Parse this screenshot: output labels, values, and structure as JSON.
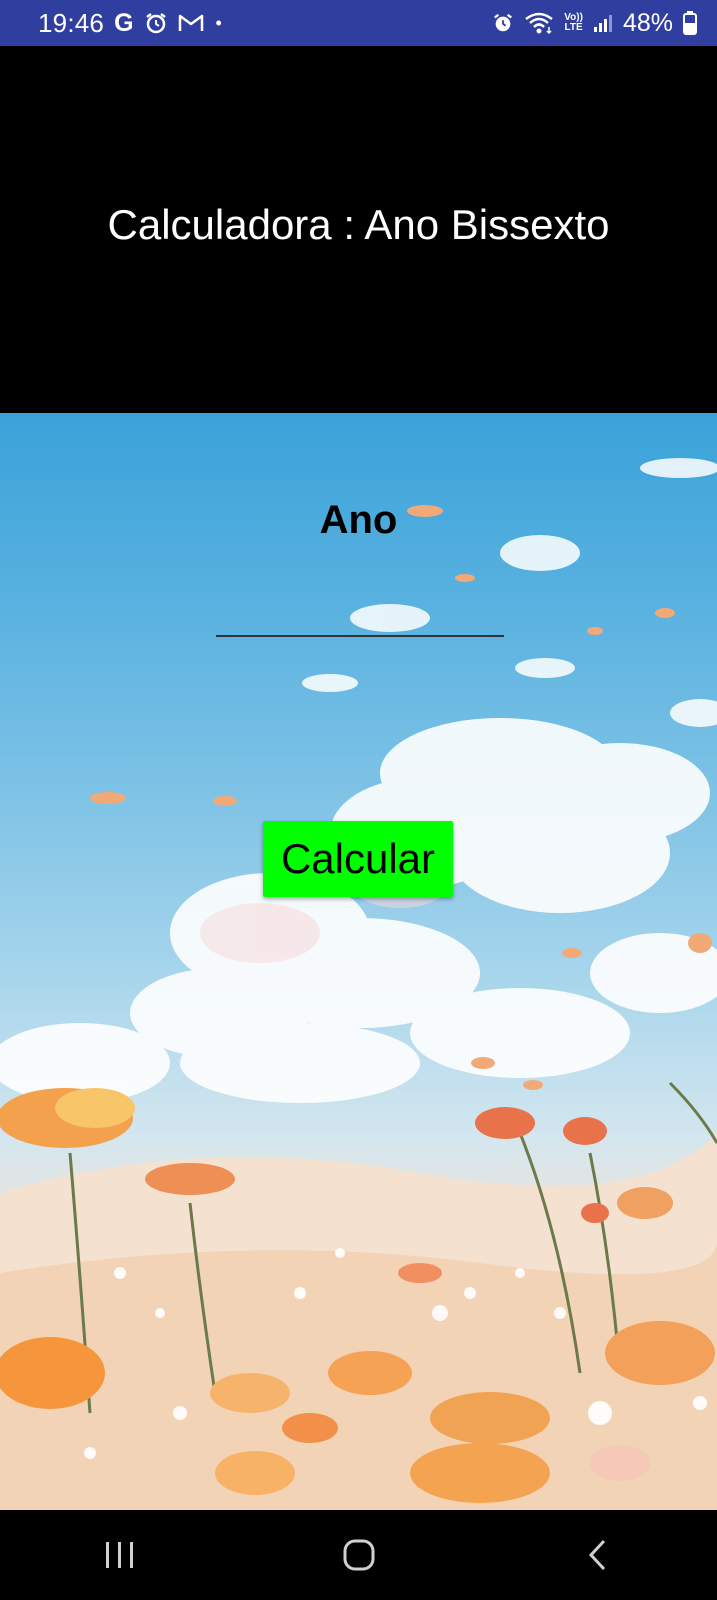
{
  "status_bar": {
    "time": "19:46",
    "notification_icons": [
      "google-g-icon",
      "alarm-icon",
      "gmail-icon",
      "dot-icon"
    ],
    "g_glyph": "G",
    "dot_glyph": "•",
    "system_icons": [
      "alarm-icon",
      "wifi-icon",
      "volte-lte-icon",
      "signal-icon",
      "battery-icon"
    ],
    "lte_top": "Vo))",
    "lte_bottom": "LTE",
    "battery_percent": "48%"
  },
  "app": {
    "title": "Calculadora : Ano Bissexto"
  },
  "form": {
    "year_label": "Ano",
    "year_value": "",
    "year_placeholder": "",
    "calculate_label": "Calcular"
  },
  "navigation": {
    "items": [
      "recent-apps-icon",
      "home-icon",
      "back-icon"
    ]
  },
  "colors": {
    "status_bar_bg": "#303f9f",
    "title_bg": "#000000",
    "title_text": "#ffffff",
    "button_bg": "#00ff00",
    "nav_bg": "#000000"
  }
}
